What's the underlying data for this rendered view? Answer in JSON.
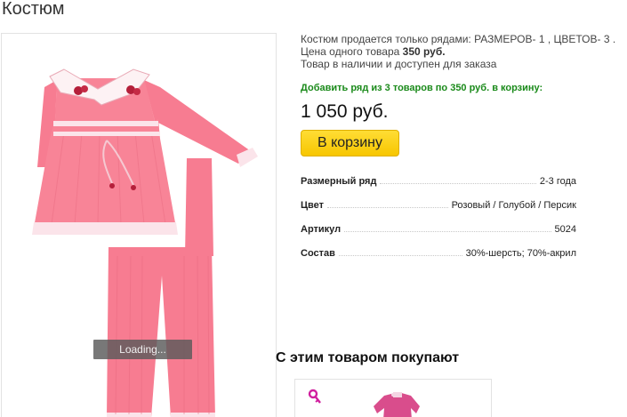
{
  "product": {
    "title": "Костюм",
    "loading_text": "Loading...",
    "info_line1": "Костюм продается только рядами: РАЗМЕРОВ- 1 , ЦВЕТОВ- 3 .",
    "info_line2_prefix": "Цена одного товара ",
    "info_line2_price": "350 руб.",
    "info_line3": "Товар в наличии и доступен для заказа",
    "add_row_text": "Добавить ряд из 3 товаров по 350 руб. в корзину:",
    "price": "1 050 руб.",
    "cart_button_label": "В корзину"
  },
  "specs": [
    {
      "label": "Размерный ряд",
      "value": "2-3 года"
    },
    {
      "label": "Цвет",
      "value": "Розовый / Голубой / Персик"
    },
    {
      "label": "Артикул",
      "value": "5024"
    },
    {
      "label": "Состав",
      "value": "30%-шерсть; 70%-акрил"
    }
  ],
  "related": {
    "title": "С этим товаром покупают",
    "icon": "key-icon"
  },
  "colors": {
    "accent_green": "#1a8a1a",
    "button_yellow": "#ffd21f",
    "garment_pink": "#f77c91"
  }
}
